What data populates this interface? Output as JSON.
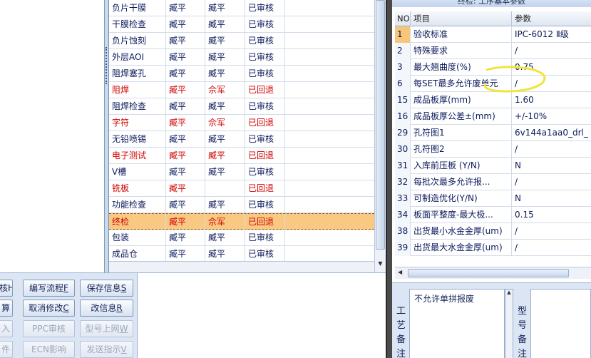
{
  "process_grid": {
    "rows": [
      {
        "step": "负片干膜",
        "maker": "臧平",
        "checker": "臧平",
        "status": "已审核",
        "color": "blue"
      },
      {
        "step": "干膜检查",
        "maker": "臧平",
        "checker": "臧平",
        "status": "已审核",
        "color": "blue"
      },
      {
        "step": "负片蚀刻",
        "maker": "臧平",
        "checker": "臧平",
        "status": "已审核",
        "color": "blue"
      },
      {
        "step": "外层AOI",
        "maker": "臧平",
        "checker": "臧平",
        "status": "已审核",
        "color": "blue"
      },
      {
        "step": "阻焊塞孔",
        "maker": "臧平",
        "checker": "臧平",
        "status": "已审核",
        "color": "blue"
      },
      {
        "step": "阻焊",
        "maker": "臧平",
        "checker": "佘军",
        "status": "已回退",
        "color": "red"
      },
      {
        "step": "阻焊检查",
        "maker": "臧平",
        "checker": "臧平",
        "status": "已审核",
        "color": "blue"
      },
      {
        "step": "字符",
        "maker": "臧平",
        "checker": "佘军",
        "status": "已回退",
        "color": "red"
      },
      {
        "step": "无铅喷锡",
        "maker": "臧平",
        "checker": "臧平",
        "status": "已审核",
        "color": "blue"
      },
      {
        "step": "电子测试",
        "maker": "臧平",
        "checker": "臧平",
        "status": "已回退",
        "color": "red"
      },
      {
        "step": "V槽",
        "maker": "臧平",
        "checker": "臧平",
        "status": "已审核",
        "color": "blue"
      },
      {
        "step": "铣板",
        "maker": "臧平",
        "checker": "",
        "status": "已回退",
        "color": "red"
      },
      {
        "step": "功能检查",
        "maker": "臧平",
        "checker": "臧平",
        "status": "已审核",
        "color": "blue"
      },
      {
        "step": "终检",
        "maker": "臧平",
        "checker": "佘军",
        "status": "已回退",
        "color": "red",
        "selected": true
      },
      {
        "step": "包装",
        "maker": "臧平",
        "checker": "臧平",
        "status": "已审核",
        "color": "blue"
      },
      {
        "step": "成品仓",
        "maker": "臧平",
        "checker": "臧平",
        "status": "已审核",
        "color": "blue"
      }
    ]
  },
  "params": {
    "title": "终检: 工序基本参数",
    "headers": {
      "no": "NO",
      "item": "项目",
      "value": "参数"
    },
    "rows": [
      {
        "no": "1",
        "item": "验收标准",
        "value": "IPC-6012 Ⅱ级"
      },
      {
        "no": "2",
        "item": "特殊要求",
        "value": "/"
      },
      {
        "no": "3",
        "item": "最大翘曲度(%)",
        "value": "0.75"
      },
      {
        "no": "6",
        "item": "每SET最多允许废单元",
        "value": "/"
      },
      {
        "no": "15",
        "item": "成品板厚(mm)",
        "value": "1.60"
      },
      {
        "no": "16",
        "item": "成品板厚公差±(mm)",
        "value": "+/-10%"
      },
      {
        "no": "29",
        "item": "孔符图1",
        "value": "6v144a1aa0_drl_"
      },
      {
        "no": "30",
        "item": "孔符图2",
        "value": "/"
      },
      {
        "no": "31",
        "item": "入库前压板 (Y/N)",
        "value": "N"
      },
      {
        "no": "32",
        "item": "每批次最多允许报...",
        "value": "/"
      },
      {
        "no": "33",
        "item": "可制造优化(Y/N)",
        "value": "N"
      },
      {
        "no": "34",
        "item": "板面平整度-最大极...",
        "value": "0.15"
      },
      {
        "no": "38",
        "item": "出货最小水金金厚(um)",
        "value": "/"
      },
      {
        "no": "39",
        "item": "出货最大水金金厚(um)",
        "value": "/"
      }
    ]
  },
  "buttons": {
    "col0": [
      "核H",
      "算",
      "入",
      "件"
    ],
    "edit_flow": {
      "label": "编写流程",
      "key": "F"
    },
    "save_info": {
      "label": "保存信息",
      "key": "S"
    },
    "cancel_edit": {
      "label": "取消修改",
      "key": "C"
    },
    "modify_info": {
      "label": "改信息",
      "key": "R"
    },
    "ppc_review": {
      "label": "PPC审核"
    },
    "model_online": {
      "label": "型号上网",
      "key": "W"
    },
    "ecn_impact": {
      "label": "ECN影响"
    },
    "send_instruction": {
      "label": "发送指示",
      "key": "V"
    }
  },
  "remarks": {
    "craft_label": "工艺备注",
    "craft_text": "不允许单拼报废",
    "model_label": "型号备注"
  },
  "colors": {
    "text_blue": "#0b1a5c",
    "text_red": "#d10000",
    "selected_row": "#f9c983",
    "annotation": "#f2e43a"
  }
}
